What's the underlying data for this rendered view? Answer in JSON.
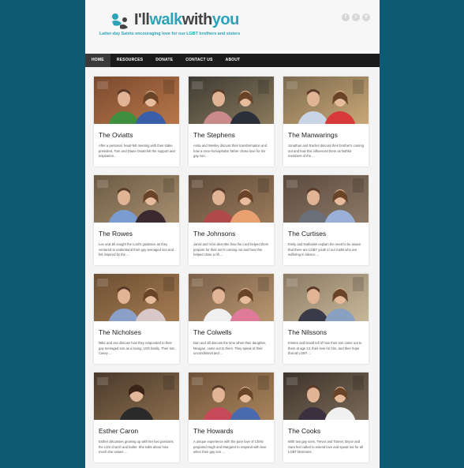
{
  "site": {
    "logo_prefix": "I'll",
    "logo_accent1": "walk",
    "logo_mid": "with",
    "logo_accent2": "you",
    "tagline": "Latter-day Saints encouraging love for our LGBT brothers and sisters",
    "social": [
      {
        "icon": "facebook-icon",
        "glyph": "f"
      },
      {
        "icon": "twitter-icon",
        "glyph": "t"
      },
      {
        "icon": "search-icon",
        "glyph": "⚲"
      }
    ],
    "accent_color": "#2aa3b8"
  },
  "nav": {
    "items": [
      "HOME",
      "RESOURCES",
      "DONATE",
      "CONTACT US",
      "ABOUT"
    ],
    "active": "HOME"
  },
  "cards": [
    {
      "title": "The Oviatts",
      "desc": "After a personal, heart-felt meeting with their stake president, Tom and Diane Oviatt felt the support and inspiration..."
    },
    {
      "title": "The Stephens",
      "desc": "Anita and Wesley discuss their transformation and how a once-homophobic father chose love for his gay son."
    },
    {
      "title": "The Manwarings",
      "desc": "Jonathan and Rachel discuss their brother's coming out and how this influenced them as faithful members of the ..."
    },
    {
      "title": "The Rowes",
      "desc": "Lee and Jill sought the Lord's guidance as they ventured to understand their gay teenaged son and felt inspired by the ..."
    },
    {
      "title": "The Johnsons",
      "desc": "Jared and Vicki describe how the Lord helped them prepare for their son's coming out and how this helped close a rift ..."
    },
    {
      "title": "The Curtises",
      "desc": "Emily and Nathaniel explain the need to be aware that there are LGBT youth in our midst who are suffering in silence ..."
    },
    {
      "title": "The Nicholses",
      "desc": "Mike and Jan discuss how they responded to their gay teenaged son as a loving, LDS family. Their son Casey ..."
    },
    {
      "title": "The Colwells",
      "desc": "Dan and Jill discuss the time when their daughter, Meagan, came out to them. They speak of their unconditional and ..."
    },
    {
      "title": "The Nilssons",
      "desc": "Kirsten and David tell of how their son came out to them at age 13, their love for him, and their hope that all LGBT ..."
    },
    {
      "title": "Esther Caron",
      "desc": "Esther discusses growing up with her two passions: the LDS church and ballet. She talks about how much she values ..."
    },
    {
      "title": "The Howards",
      "desc": "A unique experience with the pure love of Christ prepared Hugh and Margaret to respond with love when their gay son ..."
    },
    {
      "title": "The Cooks",
      "desc": "With two gay sons, Trevor and Tanner, Bryce and Sara feel called to extend love and speak out for all LGBT Mormons."
    }
  ]
}
